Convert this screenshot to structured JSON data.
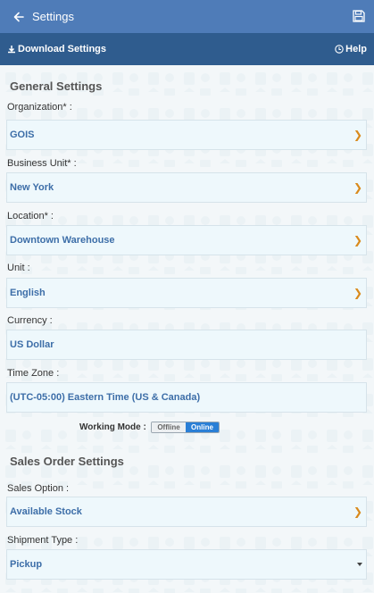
{
  "topbar": {
    "title": "Settings",
    "back_icon": "arrow-left-icon",
    "save_icon": "save-icon"
  },
  "subbar": {
    "download_label": "Download Settings",
    "help_label": "Help"
  },
  "general": {
    "title": "General Settings",
    "organization": {
      "label": "Organization* :",
      "value": "GOIS"
    },
    "business_unit": {
      "label": "Business Unit* :",
      "value": "New York"
    },
    "location": {
      "label": "Location* :",
      "value": "Downtown Warehouse"
    },
    "unit": {
      "label": "Unit :",
      "value": "English"
    },
    "currency": {
      "label": "Currency :",
      "value": "US Dollar"
    },
    "timezone": {
      "label": "Time Zone :",
      "value": "(UTC-05:00) Eastern Time (US & Canada)"
    },
    "working_mode": {
      "label": "Working Mode :",
      "off": "Offline",
      "on": "Online",
      "selected": "Online"
    }
  },
  "sales": {
    "title": "Sales Order Settings",
    "sales_option": {
      "label": "Sales Option :",
      "value": "Available Stock"
    },
    "shipment_type": {
      "label": "Shipment Type :",
      "value": "Pickup"
    }
  },
  "colors": {
    "topbar": "#4f7cb8",
    "subbar": "#2f5c8e",
    "value_text": "#3d6ea8",
    "chevron": "#d98a1c",
    "toggle_on": "#2a7fd6"
  }
}
